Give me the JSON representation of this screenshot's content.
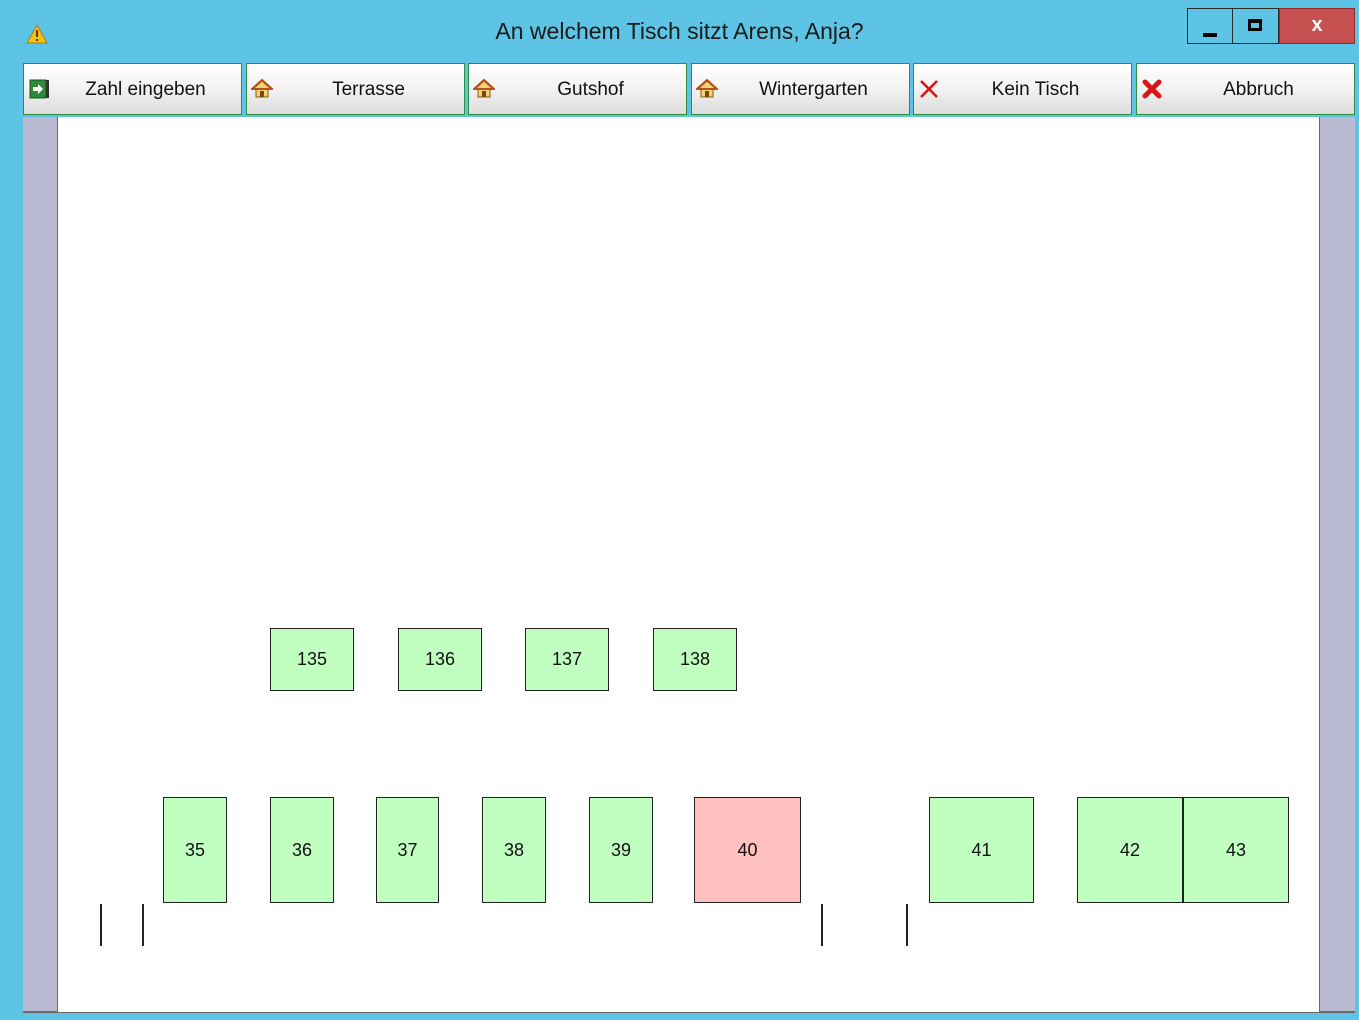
{
  "window": {
    "title": "An welchem Tisch sitzt Arens, Anja?",
    "controls": {
      "minimize": "",
      "maximize": "",
      "close": "x"
    }
  },
  "toolbar": {
    "buttons": [
      {
        "label": "Zahl eingeben",
        "icon": "enter-arrow-icon"
      },
      {
        "label": "Terrasse",
        "icon": "house-icon"
      },
      {
        "label": "Gutshof",
        "icon": "house-icon"
      },
      {
        "label": "Wintergarten",
        "icon": "house-icon"
      },
      {
        "label": "Kein Tisch",
        "icon": "red-x-icon"
      },
      {
        "label": "Abbruch",
        "icon": "red-x-bold-icon"
      }
    ]
  },
  "tables": {
    "upper": [
      "135",
      "136",
      "137",
      "138"
    ],
    "lower": [
      "35",
      "36",
      "37",
      "38",
      "39",
      "40",
      "41",
      "42",
      "43"
    ]
  },
  "colors": {
    "free": "#c0ffc0",
    "occupied": "#ffc0c0",
    "titlebar": "#5ec4e6",
    "close": "#c75050",
    "side_frame": "#babbd2"
  },
  "occupied_tables": [
    "40"
  ]
}
